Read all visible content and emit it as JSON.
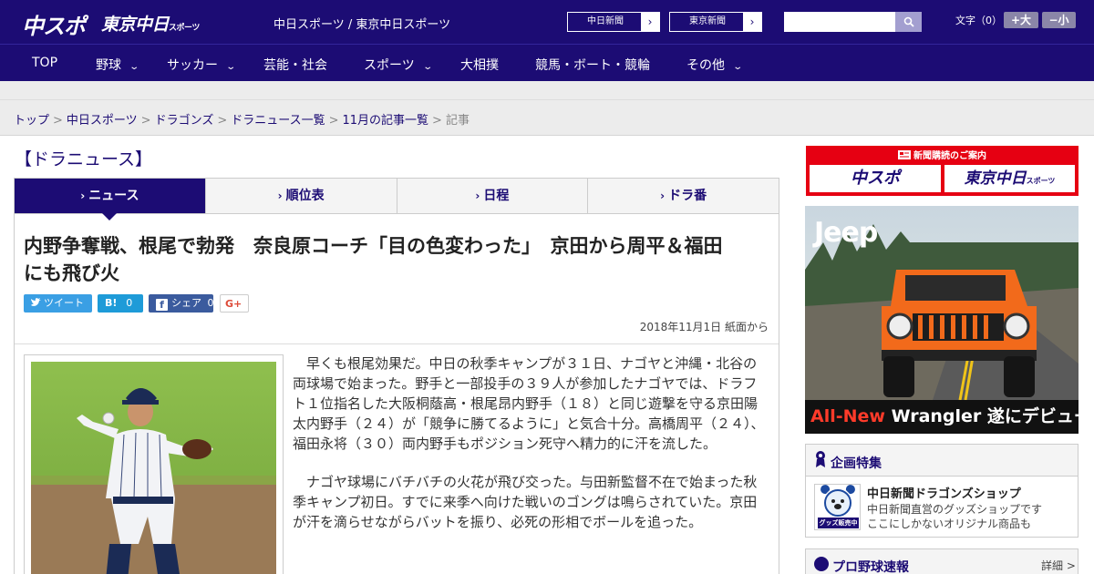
{
  "header": {
    "logo_chuspo": "中スポ",
    "logo_tokyo": "東京中日",
    "logo_tokyo_small": "スポーツ",
    "site_name": "中日スポーツ / 東京中日スポーツ",
    "ext_links": [
      {
        "label": "中日新聞",
        "arrow": "›"
      },
      {
        "label": "東京新聞",
        "arrow": "›"
      }
    ],
    "search_placeholder": "",
    "font_size_label": "文字（0）",
    "font_bigger": "+大",
    "font_smaller": "−小"
  },
  "nav": [
    {
      "label": "TOP",
      "chevron": ""
    },
    {
      "label": "野球",
      "chevron": "⌄"
    },
    {
      "label": "サッカー",
      "chevron": "⌄"
    },
    {
      "label": "芸能・社会",
      "chevron": ""
    },
    {
      "label": "スポーツ",
      "chevron": "⌄"
    },
    {
      "label": "大相撲",
      "chevron": ""
    },
    {
      "label": "競馬・ボート・競輪",
      "chevron": ""
    },
    {
      "label": "その他",
      "chevron": "⌄"
    }
  ],
  "breadcrumb": [
    {
      "label": "トップ"
    },
    {
      "label": "中日スポーツ"
    },
    {
      "label": "ドラゴンズ"
    },
    {
      "label": "ドラニュース一覧"
    },
    {
      "label": "11月の記事一覧"
    },
    {
      "label": "記事"
    }
  ],
  "breadcrumb_sep": ">",
  "section_title": "【ドラニュース】",
  "tabs": [
    {
      "label": "ニュース",
      "active": true
    },
    {
      "label": "順位表",
      "active": false
    },
    {
      "label": "日程",
      "active": false
    },
    {
      "label": "ドラ番",
      "active": false
    }
  ],
  "tab_marker": "›",
  "article": {
    "headline_line1": "内野争奪戦、根尾で勃発　奈良原コーチ「目の色変わった」　京田から周平＆福田",
    "headline_line2": "にも飛び火",
    "share": {
      "tweet": "ツイート",
      "hatena_logo": "B!",
      "hatena_count": "0",
      "fb_label": "シェア",
      "fb_count": "0",
      "gplus": "G+"
    },
    "dateline": "2018年11月1日 紙面から",
    "paragraphs": [
      "早くも根尾効果だ。中日の秋季キャンプが３１日、ナゴヤと沖縄・北谷の両球場で始まった。野手と一部投手の３９人が参加したナゴヤでは、ドラフト１位指名した大阪桐蔭高・根尾昂内野手（１８）と同じ遊撃を守る京田陽太内野手（２４）が「競争に勝てるように」と気合十分。高橋周平（２４）、福田永将（３０）両内野手もポジション死守へ精力的に汗を流した。",
      "ナゴヤ球場にバチバチの火花が飛び交った。与田新監督不在で始まった秋季キャンプ初日。すでに来季へ向けた戦いのゴングは鳴らされていた。京田が汗を滴らせながらバットを振り、必死の形相でボールを追った。"
    ]
  },
  "sidebar": {
    "subscribe_caption": "新聞購読のご案内",
    "subscribe_left": "中スポ",
    "subscribe_right": "東京中日",
    "subscribe_right_small": "スポーツ",
    "ad_brand": "Jeep",
    "ad_tagline_red": "All-New",
    "ad_tagline": "Wrangler 遂にデビュー",
    "feature_title": "企画特集",
    "shop_title": "中日新聞ドラゴンズショップ",
    "shop_desc1": "中日新聞直営のグッズショップです",
    "shop_desc2": "ここにしかないオリジナル商品も",
    "shop_badge": "グッズ販売中",
    "pro_title": "プロ野球速報",
    "pro_more": "詳細 >"
  },
  "colors": {
    "brand": "#1c0c74",
    "subscribe_red": "#e60012",
    "twitter": "#3a9fe4",
    "hatena": "#1e9bd8",
    "facebook": "#3b5b9e"
  }
}
